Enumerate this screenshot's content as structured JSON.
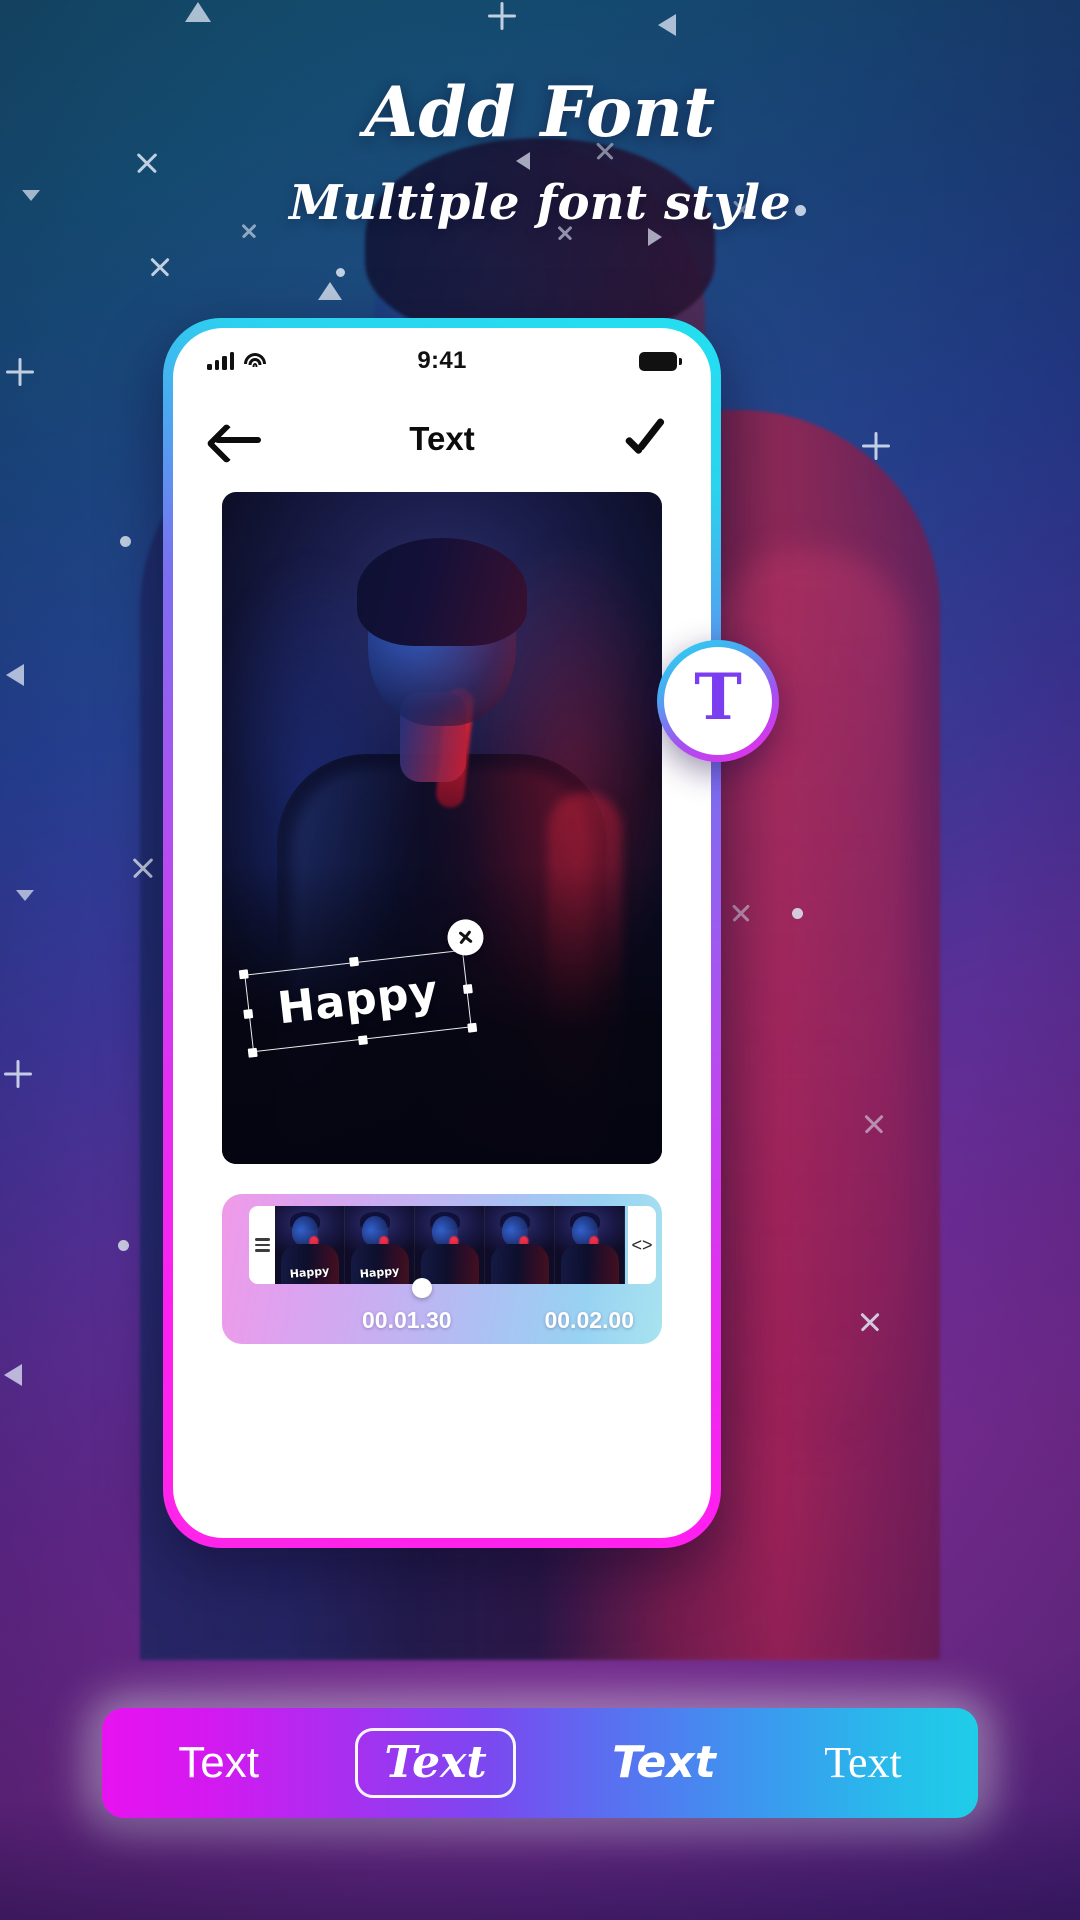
{
  "promo": {
    "headline": "Add Font",
    "subhead": "Multiple font style"
  },
  "phone": {
    "status_bar": {
      "time": "9:41",
      "signal_icon": "signal-bars-icon",
      "wifi_icon": "wifi-icon",
      "battery_icon": "battery-full-icon"
    },
    "header": {
      "back_icon": "back-arrow-icon",
      "title": "Text",
      "confirm_icon": "checkmark-icon"
    },
    "canvas": {
      "sticker_text": "Happy",
      "close_icon": "close-circle-icon",
      "handles": 8,
      "rotation_deg": -6.5
    },
    "add_text_button": {
      "glyph": "T",
      "name": "add-text-icon"
    },
    "timeline": {
      "drag_handle_icon": "hamburger-handle-icon",
      "expand_icon": "<>",
      "current_time": "00.01.30",
      "total_time": "00.02.00",
      "clip_captions": [
        "Happy",
        "Happy",
        "",
        "",
        ""
      ],
      "frame_count": 5
    }
  },
  "font_bar": {
    "options": [
      {
        "label": "Text",
        "style": "sans",
        "selected": false
      },
      {
        "label": "Text",
        "style": "script",
        "selected": true
      },
      {
        "label": "Text",
        "style": "marker",
        "selected": false
      },
      {
        "label": "Text",
        "style": "thin",
        "selected": false
      }
    ]
  },
  "colors": {
    "accent_magenta": "#e713f0",
    "accent_cyan": "#1fcde8",
    "accent_purple": "#7b3df0",
    "frame_gradient_start": "#23e0f0",
    "frame_gradient_end": "#ff25e8"
  }
}
